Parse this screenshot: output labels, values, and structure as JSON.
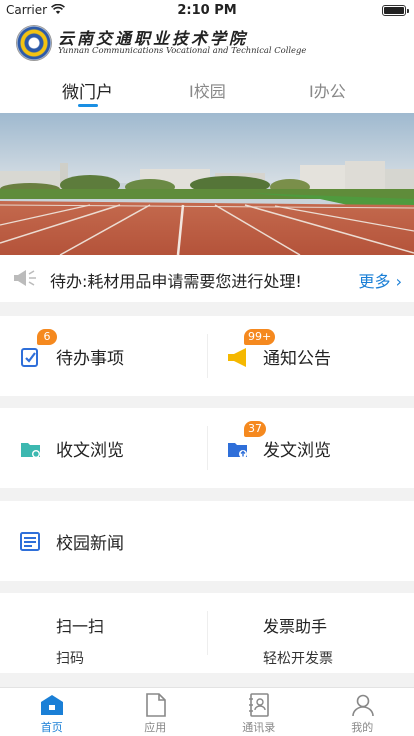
{
  "status_bar": {
    "carrier": "Carrier",
    "time": "2:10 PM"
  },
  "header": {
    "school_name": "云南交通职业技术学院",
    "school_name_en": "Yunnan Communications Vocational and Technical College"
  },
  "tabs": [
    {
      "label": "微门户",
      "active": true
    },
    {
      "label": "I校园",
      "active": false
    },
    {
      "label": "I办公",
      "active": false
    }
  ],
  "notice": {
    "text": "待办:耗材用品申请需要您进行处理!",
    "more_label": "更多"
  },
  "quick_grid_1": [
    {
      "label": "待办事项",
      "badge": "6",
      "icon": "todo-check-icon"
    },
    {
      "label": "通知公告",
      "badge": "99+",
      "icon": "megaphone-icon"
    }
  ],
  "quick_grid_2": [
    {
      "label": "收文浏览",
      "badge": "",
      "icon": "inbox-folder-icon"
    },
    {
      "label": "发文浏览",
      "badge": "37",
      "icon": "outbox-folder-icon"
    }
  ],
  "news": {
    "label": "校园新闻",
    "icon": "newspaper-icon"
  },
  "tools": [
    {
      "title": "扫一扫",
      "subtitle": "扫码"
    },
    {
      "title": "发票助手",
      "subtitle": "轻松开发票"
    }
  ],
  "tabbar": [
    {
      "label": "首页",
      "icon": "home-icon",
      "active": true
    },
    {
      "label": "应用",
      "icon": "document-icon",
      "active": false
    },
    {
      "label": "通讯录",
      "icon": "contacts-book-icon",
      "active": false
    },
    {
      "label": "我的",
      "icon": "person-icon",
      "active": false
    }
  ],
  "colors": {
    "accent": "#1a7fd6",
    "badge": "#f5891f",
    "icon_blue": "#2f6fd9",
    "icon_teal": "#3cb8b0",
    "icon_yellow": "#f5b800"
  }
}
